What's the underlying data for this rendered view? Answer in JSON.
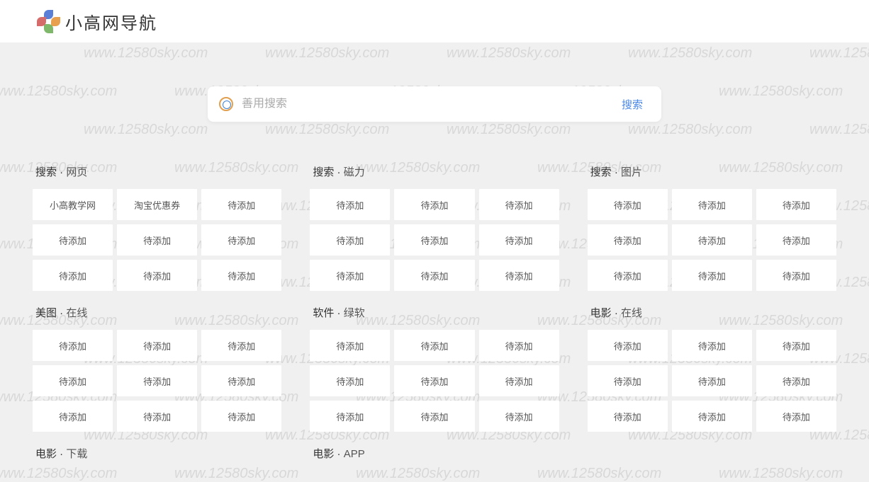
{
  "watermark_text": "www.12580sky.com",
  "header": {
    "title": "小高网导航"
  },
  "search": {
    "placeholder": "善用搜索",
    "button_label": "搜索"
  },
  "categories": [
    {
      "title_main": "搜索",
      "title_sub": "网页",
      "tiles": [
        "小高教学网",
        "淘宝优惠券",
        "待添加",
        "待添加",
        "待添加",
        "待添加",
        "待添加",
        "待添加",
        "待添加"
      ]
    },
    {
      "title_main": "搜索",
      "title_sub": "磁力",
      "tiles": [
        "待添加",
        "待添加",
        "待添加",
        "待添加",
        "待添加",
        "待添加",
        "待添加",
        "待添加",
        "待添加"
      ]
    },
    {
      "title_main": "搜索",
      "title_sub": "图片",
      "tiles": [
        "待添加",
        "待添加",
        "待添加",
        "待添加",
        "待添加",
        "待添加",
        "待添加",
        "待添加",
        "待添加"
      ]
    },
    {
      "title_main": "美图",
      "title_sub": "在线",
      "tiles": [
        "待添加",
        "待添加",
        "待添加",
        "待添加",
        "待添加",
        "待添加",
        "待添加",
        "待添加",
        "待添加"
      ]
    },
    {
      "title_main": "软件",
      "title_sub": "绿软",
      "tiles": [
        "待添加",
        "待添加",
        "待添加",
        "待添加",
        "待添加",
        "待添加",
        "待添加",
        "待添加",
        "待添加"
      ]
    },
    {
      "title_main": "电影",
      "title_sub": "在线",
      "tiles": [
        "待添加",
        "待添加",
        "待添加",
        "待添加",
        "待添加",
        "待添加",
        "待添加",
        "待添加",
        "待添加"
      ]
    }
  ],
  "partial_categories": [
    {
      "title_main": "电影",
      "title_sub": "下载"
    },
    {
      "title_main": "电影",
      "title_sub": "APP"
    }
  ],
  "dot": " · "
}
